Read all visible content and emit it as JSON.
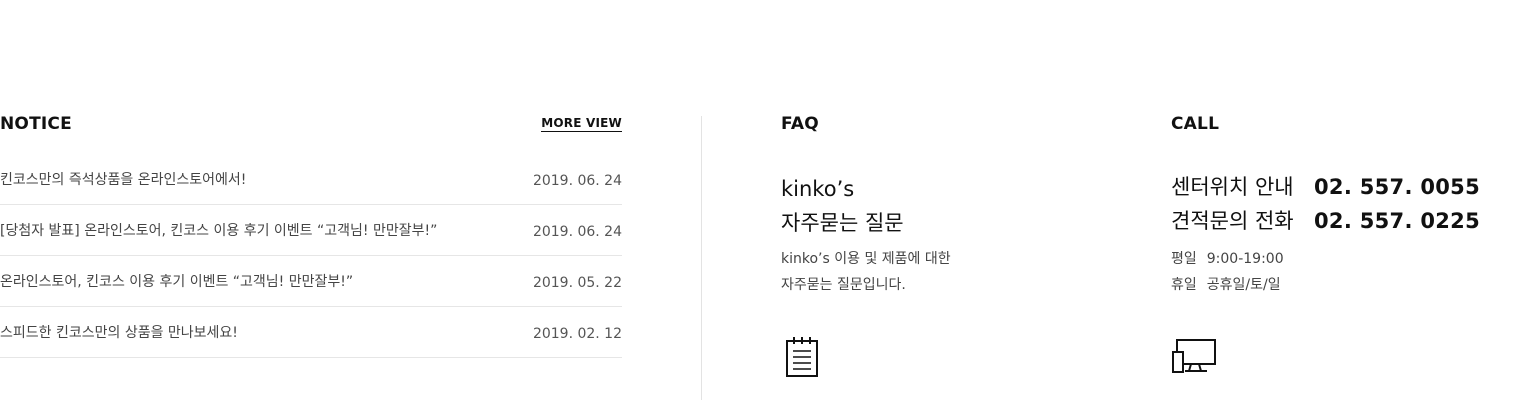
{
  "notice": {
    "title": "NOTICE",
    "more_view": "MORE VIEW",
    "items": [
      {
        "title": "킨코스만의 즉석상품을 온라인스토어에서!",
        "date": "2019. 06. 24"
      },
      {
        "title": "[당첨자 발표] 온라인스토어, 킨코스 이용 후기 이벤트 “고객님! 만만잘부!”",
        "date": "2019. 06. 24"
      },
      {
        "title": "온라인스토어, 킨코스 이용 후기 이벤트 “고객님! 만만잘부!”",
        "date": "2019. 05. 22"
      },
      {
        "title": "스피드한 킨코스만의 상품을 만나보세요!",
        "date": "2019. 02. 12"
      }
    ]
  },
  "faq": {
    "title": "FAQ",
    "heading_line1": "kinko’s",
    "heading_line2": "자주묻는 질문",
    "desc_line1": "kinko’s 이용 및 제품에 대한",
    "desc_line2": "자주묻는 질문입니다.",
    "icon": "notepad-icon"
  },
  "call": {
    "title": "CALL",
    "rows": [
      {
        "label": "센터위치 안내",
        "number": "02. 557. 0055"
      },
      {
        "label": "견적문의 전화",
        "number": "02. 557. 0225"
      }
    ],
    "hours": [
      {
        "key": "평일",
        "value": "9:00-19:00"
      },
      {
        "key": "휴일",
        "value": "공휴일/토/일"
      }
    ],
    "icon": "computer-monitor-icon"
  }
}
